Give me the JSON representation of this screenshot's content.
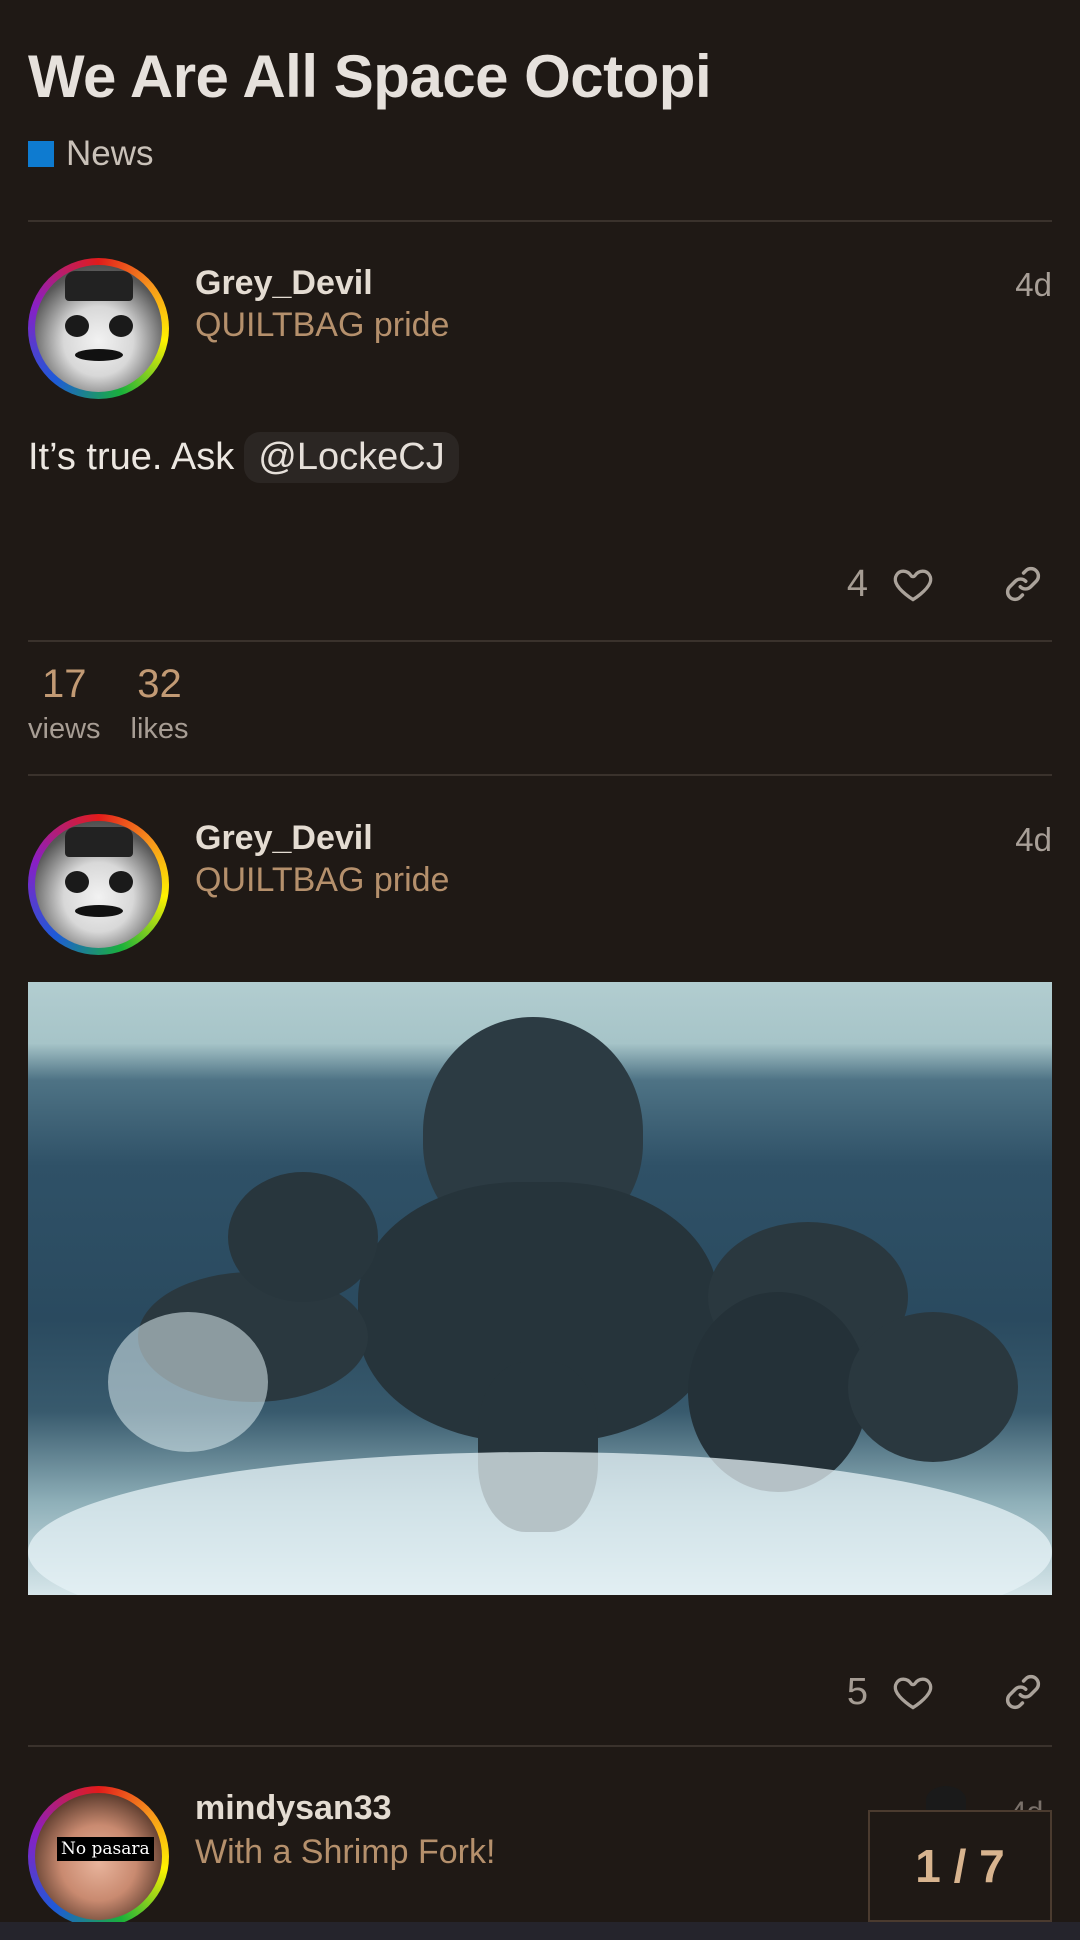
{
  "topic": {
    "title": "We Are All Space Octopi",
    "category": "News",
    "category_color": "#0e7bd0"
  },
  "posts": [
    {
      "username": "Grey_Devil",
      "user_title": "QUILTBAG pride",
      "time": "4d",
      "text": "It’s true. Ask",
      "mention": "@LockeCJ",
      "likes": "4",
      "avatar": "panda-avatar"
    },
    {
      "username": "Grey_Devil",
      "user_title": "QUILTBAG pride",
      "time": "4d",
      "image": "octopus-in-sea",
      "likes": "5",
      "avatar": "panda-avatar"
    },
    {
      "username": "mindysan33",
      "user_title": "With a Shrimp Fork!",
      "avatar_caption": "No pasara",
      "time": "4d"
    }
  ],
  "stats": {
    "views": "17",
    "views_label": "views",
    "likes": "32",
    "likes_label": "likes"
  },
  "pagination": {
    "counter": "1 / 7"
  },
  "icons": {
    "like": "heart-icon",
    "share": "link-icon"
  },
  "colors": {
    "background": "#1f1915",
    "accent": "#c29a74",
    "user_title": "#b5906c"
  }
}
